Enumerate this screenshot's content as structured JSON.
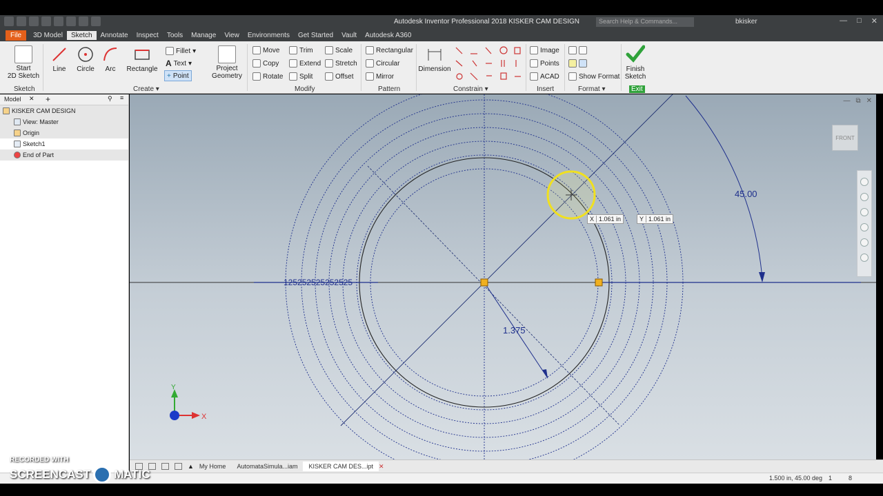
{
  "window": {
    "title": "Autodesk Inventor Professional 2018   KISKER CAM DESIGN",
    "search_placeholder": "Search Help & Commands...",
    "user": "bkisker"
  },
  "tabs": [
    "3D Model",
    "Sketch",
    "Annotate",
    "Inspect",
    "Tools",
    "Manage",
    "View",
    "Environments",
    "Get Started",
    "Vault",
    "Autodesk A360"
  ],
  "file_tab": "File",
  "active_tab": "Sketch",
  "ribbon": {
    "start_sketch": "Start\n2D Sketch",
    "start_sketch_l1": "Start",
    "start_sketch_l2": "2D Sketch",
    "sketch_panel": "Sketch",
    "line": "Line",
    "circle": "Circle",
    "arc": "Arc",
    "rectangle": "Rectangle",
    "fillet": "Fillet",
    "text": "Text",
    "point": "Point",
    "create_panel": "Create",
    "project_geometry_l1": "Project",
    "project_geometry_l2": "Geometry",
    "move": "Move",
    "copy": "Copy",
    "rotate": "Rotate",
    "trim": "Trim",
    "extend": "Extend",
    "split": "Split",
    "scale": "Scale",
    "stretch": "Stretch",
    "offset": "Offset",
    "modify_panel": "Modify",
    "rectangular": "Rectangular",
    "circular": "Circular",
    "mirror": "Mirror",
    "pattern_panel": "Pattern",
    "dimension": "Dimension",
    "constrain_panel": "Constrain",
    "image": "Image",
    "points": "Points",
    "acad": "ACAD",
    "insert_panel": "Insert",
    "show_format": "Show Format",
    "format_panel": "Format",
    "finish_l1": "Finish",
    "finish_l2": "Sketch",
    "exit_panel": "Exit"
  },
  "browser": {
    "tab_label": "Model",
    "items": [
      {
        "label": "KISKER CAM DESIGN",
        "indent": 0
      },
      {
        "label": "View: Master",
        "indent": 1
      },
      {
        "label": "Origin",
        "indent": 1
      },
      {
        "label": "Sketch1",
        "indent": 1
      },
      {
        "label": "End of Part",
        "indent": 1
      }
    ]
  },
  "graphics": {
    "viewcube_label": "FRONT",
    "angle_dim": "45.00",
    "radius_dim": "1.375",
    "overlap_text": "125252525252525",
    "coord_x_label": "X",
    "coord_x_value": "1.061 in",
    "coord_y_label": "Y",
    "coord_y_value": "1.061 in",
    "axis_x": "X",
    "axis_y": "Y"
  },
  "doc_tabs": [
    "My Home",
    "AutomataSimula...iam",
    "KISKER CAM DES...ipt"
  ],
  "active_doc": "KISKER CAM DES...ipt",
  "status": {
    "text": "1.500 in, 45.00 deg",
    "n1": "1",
    "n2": "8"
  },
  "watermark": {
    "line1": "RECORDED WITH",
    "line2a": "SCREENCAST",
    "line2b": "MATIC"
  },
  "colors": {
    "title_bar": "#3c3f41",
    "file_tab": "#e4601b",
    "sketch_geometry": "#1e2f8c",
    "highlight_circle": "#f0e020",
    "finish_check": "#2fa23a"
  }
}
